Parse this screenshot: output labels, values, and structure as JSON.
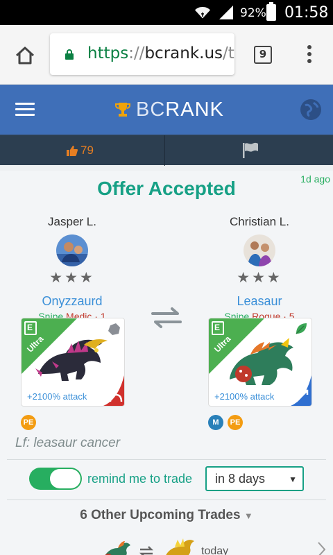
{
  "status_bar": {
    "battery": "92%",
    "time": "01:58"
  },
  "browser": {
    "url_scheme": "https",
    "url_sep": "://",
    "url_host": "bcrank.us",
    "url_rest": "/t",
    "tab_count": "9"
  },
  "header": {
    "brand_bc": "BC",
    "brand_rank": "RANK"
  },
  "subbar": {
    "likes": "79"
  },
  "trade": {
    "time_ago": "1d ago",
    "title": "Offer Accepted",
    "left": {
      "trader": "Jasper L.",
      "stars": "★★★",
      "dino": "Onyzzaurd",
      "role": "Snipe",
      "class": "Medic",
      "level": "· 1",
      "ribbon": "Ultra",
      "attack": "+2100% attack",
      "badges": [
        "PE"
      ]
    },
    "right": {
      "trader": "Christian L.",
      "stars": "★★★",
      "dino": "Leasaur",
      "role": "Snipe",
      "class": "Rogue",
      "level": "· 5",
      "ribbon": "Ultra",
      "attack": "+2100% attack",
      "badges": [
        "M",
        "PE"
      ]
    },
    "looking_for": "Lf: leasaur cancer"
  },
  "reminder": {
    "label": "remind me to trade",
    "enabled": true,
    "selected": "in 8 days"
  },
  "upcoming": {
    "heading": "6 Other Upcoming Trades",
    "first_when": "today"
  },
  "colors": {
    "header_blue": "#3f6fb8",
    "subbar_dark": "#2c3e50",
    "accent_green": "#16a085",
    "link_blue": "#3a8fd8",
    "ultra_green": "#4caf50",
    "badge_orange": "#f39c12"
  }
}
